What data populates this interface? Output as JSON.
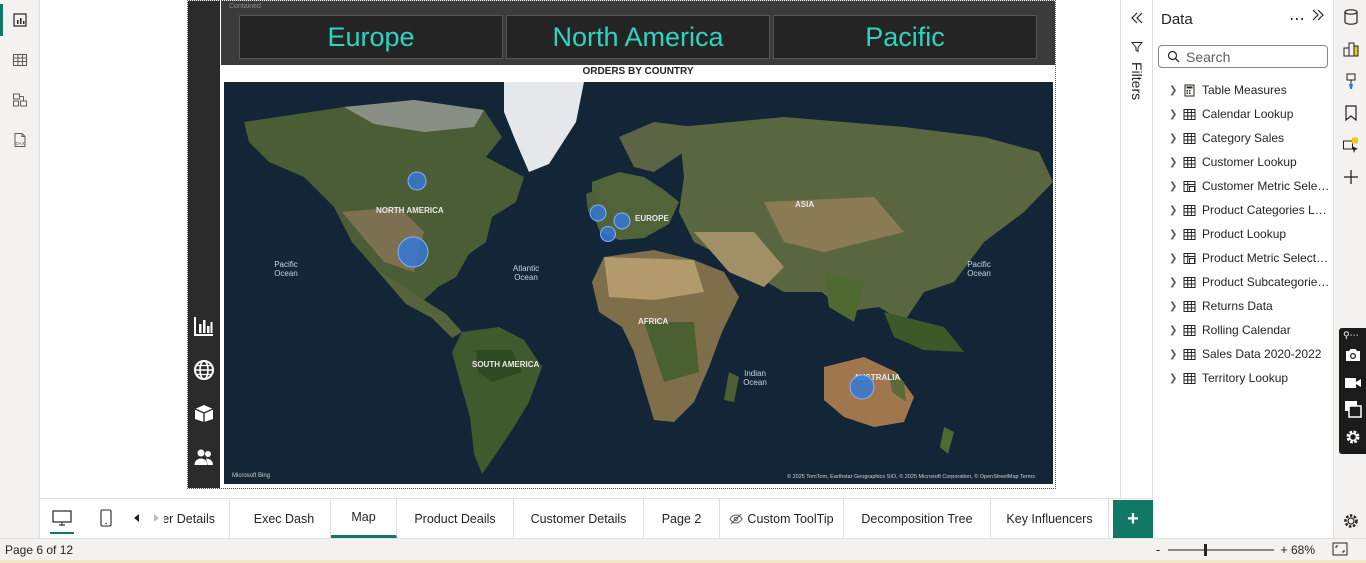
{
  "regions": {
    "label": "Contained",
    "buttons": [
      "Europe",
      "North America",
      "Pacific"
    ]
  },
  "map": {
    "title": "ORDERS BY COUNTRY",
    "labels": {
      "north_america": "NORTH AMERICA",
      "europe": "EUROPE",
      "asia": "ASIA",
      "africa": "AFRICA",
      "south_america": "SOUTH AMERICA",
      "australia": "AUSTRALIA",
      "pacific_ocean": "Pacific Ocean",
      "atlantic_ocean": "Atlantic Ocean",
      "indian_ocean": "Indian Ocean"
    },
    "logo": "Microsoft Bing",
    "attribution": "© 2025 TomTom, Earthstar Geographics SIO, © 2025 Microsoft Corporation, © OpenStreetMap  Terms"
  },
  "filters": {
    "label": "Filters"
  },
  "data_pane": {
    "title": "Data",
    "search_placeholder": "Search",
    "tables": [
      "Table Measures",
      "Calendar Lookup",
      "Category Sales",
      "Customer Lookup",
      "Customer Metric Selection",
      "Product Categories Lookup",
      "Product Lookup",
      "Product Metric Selection",
      "Product Subcategories Lookup",
      "Returns Data",
      "Rolling Calendar",
      "Sales Data 2020-2022",
      "Territory Lookup"
    ]
  },
  "tabs": {
    "items": [
      "Customer Details",
      "Exec Dash",
      "Map",
      "Product Deails",
      "Customer Details",
      "Page 2",
      "Custom ToolTip",
      "Decomposition Tree",
      "Key Influencers"
    ],
    "active_index": 2,
    "add_label": "+"
  },
  "status": {
    "page_info": "Page 6 of 12",
    "zoom_minus": "-",
    "zoom_plus": "+",
    "zoom_percent": "68%",
    "zoom_level": 0.68
  },
  "colors": {
    "accent": "#117865",
    "region_text": "#2dd4bf",
    "bubble": "#3478d6"
  }
}
